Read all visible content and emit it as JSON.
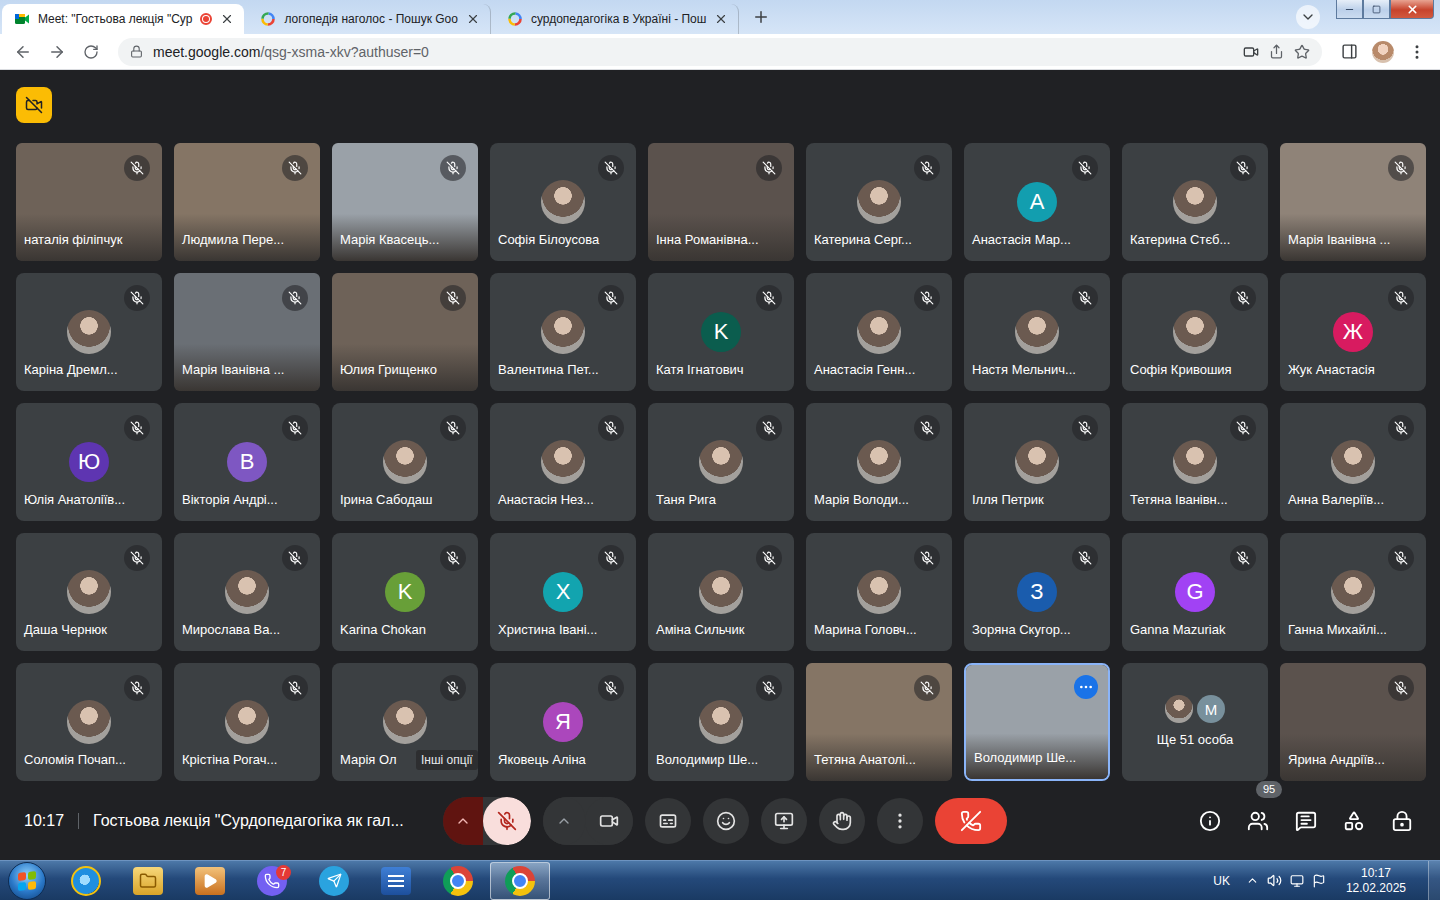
{
  "browser": {
    "tabs": [
      {
        "label": "Meet: \"Гостьова лекція \"Сур",
        "selected": true,
        "recording": true
      },
      {
        "label": "логопедія наголос - Пошук Goo",
        "selected": false,
        "recording": false
      },
      {
        "label": "сурдопедагогіка в Україні - Пош",
        "selected": false,
        "recording": false
      }
    ],
    "address": {
      "host": "meet.google.com",
      "path": "/qsg-xsma-xkv?authuser=0"
    }
  },
  "meeting": {
    "time": "10:17",
    "title": "Гостьова лекція \"Сурдопедагогіка як гал...",
    "people_count": "95",
    "mic_muted": true
  },
  "tiles": [
    {
      "name": "наталія філіпчук",
      "kind": "video",
      "muted": true,
      "speaking": false
    },
    {
      "name": "Людмила Пере...",
      "kind": "video",
      "muted": true,
      "speaking": false
    },
    {
      "name": "Марія Квасець...",
      "kind": "video",
      "muted": true,
      "speaking": false
    },
    {
      "name": "Софія Білоусова",
      "kind": "photo",
      "muted": true,
      "speaking": false
    },
    {
      "name": "Інна Романівна...",
      "kind": "video",
      "muted": true,
      "speaking": false
    },
    {
      "name": "Катерина Серг...",
      "kind": "photo",
      "muted": true,
      "speaking": false
    },
    {
      "name": "Анастасія Мар...",
      "kind": "letter",
      "letter": "A",
      "color": "#129eaf",
      "muted": true,
      "speaking": false
    },
    {
      "name": "Катерина Стєб...",
      "kind": "photo",
      "muted": true,
      "speaking": false
    },
    {
      "name": "Марія Іванівна ...",
      "kind": "video",
      "muted": true,
      "speaking": false
    },
    {
      "name": "Каріна Дремл...",
      "kind": "photo",
      "muted": true,
      "speaking": false
    },
    {
      "name": "Марія Іванівна ...",
      "kind": "video",
      "muted": true,
      "speaking": false
    },
    {
      "name": "Юлия Грищенко",
      "kind": "video",
      "muted": true,
      "speaking": false
    },
    {
      "name": "Валентина Пет...",
      "kind": "photo",
      "muted": true,
      "speaking": false
    },
    {
      "name": "Катя Ігнатович",
      "kind": "letter",
      "letter": "K",
      "color": "#0b5d4e",
      "muted": true,
      "speaking": false
    },
    {
      "name": "Анастасія Генн...",
      "kind": "photo",
      "muted": true,
      "speaking": false
    },
    {
      "name": "Настя Мельнич...",
      "kind": "photo",
      "muted": true,
      "speaking": false
    },
    {
      "name": "Софія Кривошия",
      "kind": "photo",
      "muted": true,
      "speaking": false
    },
    {
      "name": "Жук Анастасія",
      "kind": "letter",
      "letter": "Ж",
      "color": "#d81b60",
      "muted": true,
      "speaking": false
    },
    {
      "name": "Юлія Анатоліїв...",
      "kind": "letter",
      "letter": "Ю",
      "color": "#5e35b1",
      "muted": true,
      "speaking": false
    },
    {
      "name": "Вікторія Андрі...",
      "kind": "letter",
      "letter": "B",
      "color": "#7e57c2",
      "muted": true,
      "speaking": false
    },
    {
      "name": "Ірина Сабодаш",
      "kind": "photo",
      "muted": true,
      "speaking": false
    },
    {
      "name": "Анастасія Нез...",
      "kind": "photo",
      "muted": true,
      "speaking": false
    },
    {
      "name": "Таня Рига",
      "kind": "photo",
      "muted": true,
      "speaking": false
    },
    {
      "name": "Марія Володи...",
      "kind": "photo",
      "muted": true,
      "speaking": false
    },
    {
      "name": "Ілля Петрик",
      "kind": "photo",
      "muted": true,
      "speaking": false
    },
    {
      "name": "Тетяна Іванівн...",
      "kind": "photo",
      "muted": true,
      "speaking": false
    },
    {
      "name": "Анна Валеріїв...",
      "kind": "photo",
      "muted": true,
      "speaking": false
    },
    {
      "name": "Даша Чернюк",
      "kind": "photo",
      "muted": true,
      "speaking": false
    },
    {
      "name": "Мирослава Ва...",
      "kind": "photo",
      "muted": true,
      "speaking": false
    },
    {
      "name": "Karina Chokan",
      "kind": "letter",
      "letter": "K",
      "color": "#689f38",
      "muted": true,
      "speaking": false
    },
    {
      "name": "Христина Івані...",
      "kind": "letter",
      "letter": "X",
      "color": "#12a4af",
      "muted": true,
      "speaking": false
    },
    {
      "name": "Аміна Сильчик",
      "kind": "photo",
      "muted": true,
      "speaking": false
    },
    {
      "name": "Марина Головч...",
      "kind": "photo",
      "muted": true,
      "speaking": false
    },
    {
      "name": "Зоряна Скугор...",
      "kind": "letter",
      "letter": "З",
      "color": "#1a5cad",
      "muted": true,
      "speaking": false
    },
    {
      "name": "Ganna Mazuriak",
      "kind": "letter",
      "letter": "G",
      "color": "#a142f4",
      "muted": true,
      "speaking": false
    },
    {
      "name": "Ганна Михайлі...",
      "kind": "photo",
      "muted": true,
      "speaking": false
    },
    {
      "name": "Соломія Почап...",
      "kind": "photo",
      "muted": true,
      "speaking": false
    },
    {
      "name": "Крістіна Рогач...",
      "kind": "photo",
      "muted": true,
      "speaking": false
    },
    {
      "name": "Марія Ол",
      "kind": "photo",
      "muted": true,
      "speaking": false,
      "tooltip": "Інші опції"
    },
    {
      "name": "Яковець Аліна",
      "kind": "letter",
      "letter": "Я",
      "color": "#ab47bc",
      "muted": true,
      "speaking": false
    },
    {
      "name": "Володимир Ше...",
      "kind": "photo",
      "muted": true,
      "speaking": false
    },
    {
      "name": "Тетяна Анатолі...",
      "kind": "video",
      "muted": true,
      "speaking": false
    },
    {
      "name": "Володимир Ше...",
      "kind": "video",
      "muted": false,
      "speaking": true
    },
    {
      "name": "Ще 51 особа",
      "kind": "more",
      "letter": "M",
      "color": "#78909c",
      "muted": false,
      "speaking": false
    },
    {
      "name": "Ярина Андріїв...",
      "kind": "video",
      "muted": true,
      "speaking": false
    }
  ],
  "taskbar": {
    "apps": [
      {
        "kind": "ie",
        "selected": false
      },
      {
        "kind": "explorer",
        "selected": false
      },
      {
        "kind": "media",
        "selected": false
      },
      {
        "kind": "viber",
        "selected": false,
        "badge": "7"
      },
      {
        "kind": "telegram",
        "selected": false
      },
      {
        "kind": "word",
        "selected": false
      },
      {
        "kind": "chrome",
        "selected": false
      },
      {
        "kind": "chrome",
        "selected": true
      }
    ],
    "language": "UK",
    "time": "10:17",
    "date": "12.02.2025"
  }
}
